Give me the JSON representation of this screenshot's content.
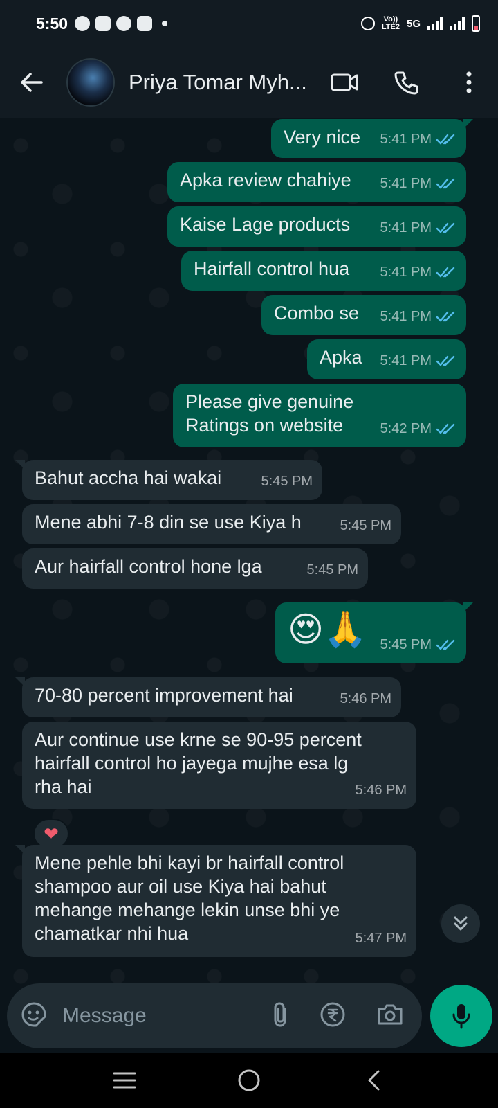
{
  "status_bar": {
    "time": "5:50",
    "network": "5G",
    "volte_line1": "Vo))",
    "volte_line2": "LTE2"
  },
  "header": {
    "contact_name": "Priya Tomar Myh...",
    "icons": [
      "back-arrow-icon",
      "video-call-icon",
      "phone-icon",
      "more-vert-icon"
    ]
  },
  "messages": [
    {
      "direction": "out",
      "text": "Very nice",
      "time": "5:41 PM",
      "status": "read"
    },
    {
      "direction": "out",
      "text": "Apka review chahiye",
      "time": "5:41 PM",
      "status": "read"
    },
    {
      "direction": "out",
      "text": "Kaise Lage products",
      "time": "5:41 PM",
      "status": "read"
    },
    {
      "direction": "out",
      "text": "Hairfall control hua",
      "time": "5:41 PM",
      "status": "read"
    },
    {
      "direction": "out",
      "text": "Combo se",
      "time": "5:41 PM",
      "status": "read"
    },
    {
      "direction": "out",
      "text": "Apka",
      "time": "5:41 PM",
      "status": "read"
    },
    {
      "direction": "out",
      "text_line1": "Please give genuine",
      "text_line2": "Ratings on website",
      "time": "5:42 PM",
      "status": "read"
    },
    {
      "direction": "in",
      "text": "Bahut accha hai wakai",
      "time": "5:45 PM"
    },
    {
      "direction": "in",
      "text": "Mene abhi 7-8 din se use Kiya h",
      "time": "5:45 PM"
    },
    {
      "direction": "in",
      "text": "Aur hairfall control hone lga",
      "time": "5:45 PM"
    },
    {
      "direction": "out",
      "text": "😍🙏",
      "time": "5:45 PM",
      "status": "read"
    },
    {
      "direction": "in",
      "text": "70-80 percent improvement hai",
      "time": "5:46 PM"
    },
    {
      "direction": "in",
      "text_line1": "Aur continue use krne se 90-95 percent",
      "text_line2": "hairfall control ho jayega mujhe esa lg",
      "text_line3": "rha hai",
      "time": "5:46 PM",
      "reaction": "❤"
    },
    {
      "direction": "in",
      "text_line1": "Mene pehle bhi kayi br hairfall control",
      "text_line2": "shampoo aur oil use Kiya hai bahut",
      "text_line3": "mehange mehange lekin unse bhi ye",
      "text_line4": "chamatkar nhi hua",
      "time": "5:47 PM"
    }
  ],
  "input": {
    "placeholder": "Message"
  },
  "colors": {
    "outgoing_bubble": "#005c4b",
    "incoming_bubble": "#202c33",
    "accent": "#00a884",
    "read_ticks": "#53bdeb"
  }
}
